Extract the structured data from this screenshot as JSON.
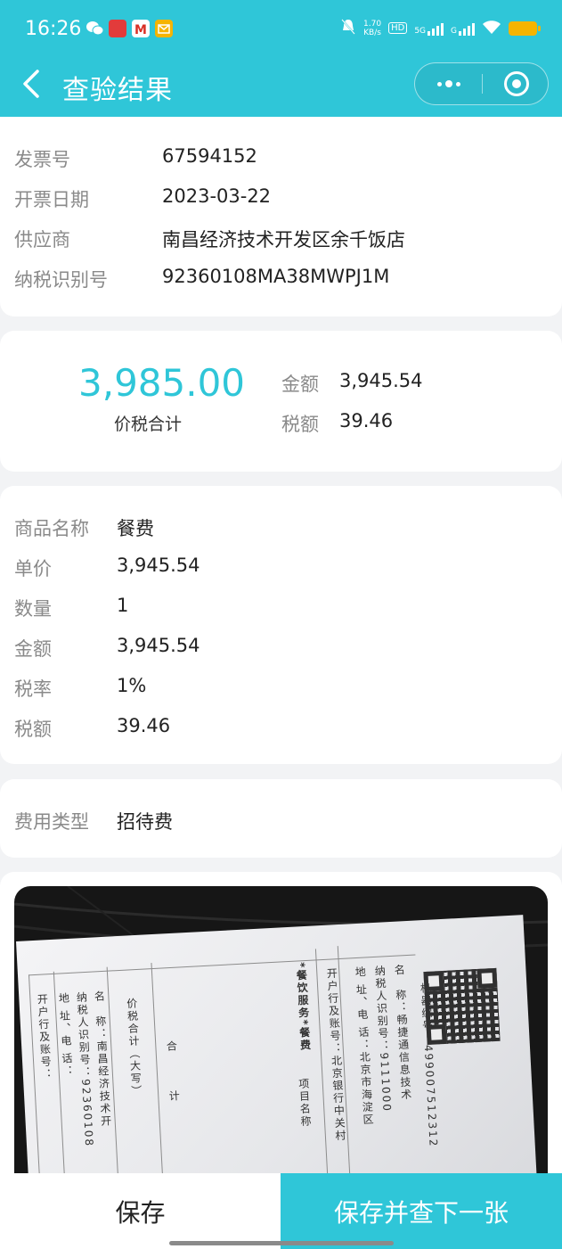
{
  "status_bar": {
    "time": "16:26",
    "net_speed_value": "1.70",
    "net_speed_unit": "KB/s",
    "hd": "HD",
    "net_5g": "5G",
    "net_g": "G"
  },
  "nav": {
    "title": "查验结果"
  },
  "invoice": [
    {
      "label": "发票号",
      "value": "67594152"
    },
    {
      "label": "开票日期",
      "value": "2023-03-22"
    },
    {
      "label": "供应商",
      "value": "南昌经济技术开发区余千饭店"
    },
    {
      "label": "纳税识别号",
      "value": "92360108MA38MWPJ1M"
    }
  ],
  "amounts": {
    "total": "3,985.00",
    "total_label": "价税合计",
    "amount_label": "金额",
    "amount": "3,945.54",
    "tax_label": "税额",
    "tax": "39.46"
  },
  "items": [
    {
      "label": "商品名称",
      "value": "餐费"
    },
    {
      "label": "单价",
      "value": "3,945.54"
    },
    {
      "label": "数量",
      "value": "1"
    },
    {
      "label": "金额",
      "value": "3,945.54"
    },
    {
      "label": "税率",
      "value": "1%"
    },
    {
      "label": "税额",
      "value": "39.46"
    }
  ],
  "expense": {
    "label": "费用类型",
    "value": "招待费"
  },
  "receipt_photo": {
    "machine_no": "机器编号：499007512312",
    "service": "*餐饮服务*餐费",
    "item_col": "项目名称",
    "total_words": "价税合计（大写）",
    "total_col": "合　　　计",
    "buyer_name": "名　称：畅捷通信息技术",
    "buyer_tax": "纳税人识别号：9111000",
    "buyer_addr": "地 址、电 话：北京市海淀区",
    "buyer_bank": "开户行及账号：北京银行中关村",
    "seller_name": "名　称：南昌经济技术开",
    "seller_tax": "纳税人识别号：92360108",
    "seller_addr": "地 址、电 话：",
    "seller_bank": "开户行及账号："
  },
  "buttons": {
    "save": "保存",
    "save_next": "保存并查下一张"
  },
  "colors": {
    "accent": "#2fc6d8",
    "battery": "#f5b400"
  }
}
